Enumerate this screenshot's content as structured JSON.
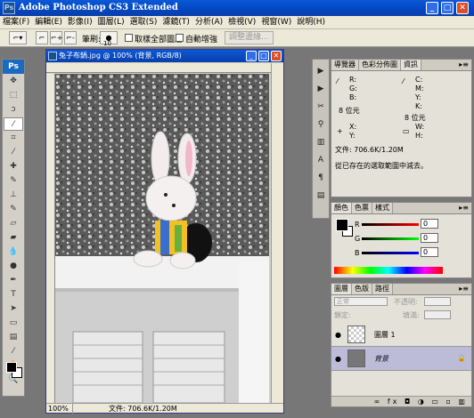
{
  "window": {
    "title": "Adobe Photoshop CS3 Extended",
    "app_icon": "Ps"
  },
  "menu": [
    "檔案(F)",
    "編輯(E)",
    "影像(I)",
    "圖層(L)",
    "選取(S)",
    "濾鏡(T)",
    "分析(A)",
    "檢視(V)",
    "視窗(W)",
    "說明(H)"
  ],
  "options_bar": {
    "brush_label": "筆刷:",
    "brush_size": "10",
    "sample_all_layers": "取樣全部圖層",
    "auto_enhance": "自動增強",
    "refine_edge": "調整邊緣..."
  },
  "document": {
    "title": "兔子布鍋.jpg @ 100% (背景, RGB/8)",
    "zoom": "100%",
    "status": "文件: 706.6K/1.20M"
  },
  "info_panel": {
    "tabs": [
      "導覽器",
      "色彩分佈圖",
      "資訊"
    ],
    "rgb_labels": [
      "R:",
      "G:",
      "B:"
    ],
    "cmyk_labels": [
      "C:",
      "M:",
      "Y:",
      "K:"
    ],
    "bit_left": "8 位元",
    "bit_right": "8 位元",
    "xy_labels": [
      "X:",
      "Y:"
    ],
    "wh_labels": [
      "W:",
      "H:"
    ],
    "doc_size": "文件: 706.6K/1.20M",
    "hint": "從已存在的選取範圍中減去。"
  },
  "color_panel": {
    "tabs": [
      "顏色",
      "色票",
      "樣式"
    ],
    "channels": [
      {
        "label": "R",
        "value": "0"
      },
      {
        "label": "G",
        "value": "0"
      },
      {
        "label": "B",
        "value": "0"
      }
    ]
  },
  "layers_panel": {
    "tabs": [
      "圖層",
      "色版",
      "路徑"
    ],
    "blend_mode": "正常",
    "opacity_label": "不透明:",
    "lock_label": "鎖定:",
    "fill_label": "填滿:",
    "layers": [
      {
        "name": "圖層 1"
      },
      {
        "name": "背景"
      }
    ]
  }
}
